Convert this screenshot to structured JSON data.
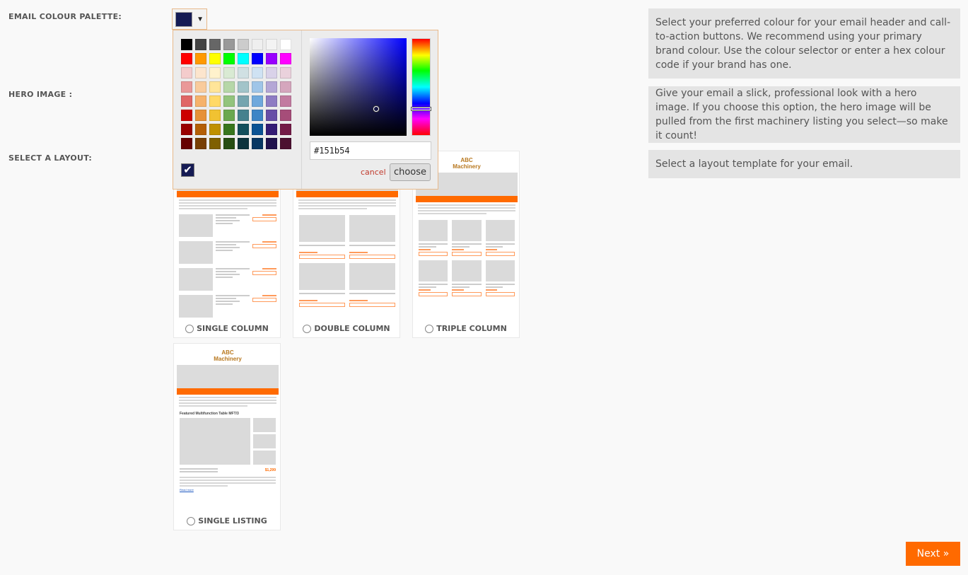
{
  "labels": {
    "email_colour_palette": "EMAIL COLOUR PALETTE:",
    "hero_image": "HERO IMAGE :",
    "select_layout": "SELECT A LAYOUT:"
  },
  "help": {
    "colour": "Select your preferred colour for your email header and call-to-action buttons. We recommend using your primary brand colour. Use the colour selector or enter a hex colour code if your brand has one.",
    "hero": "Give your email a slick, professional look with a hero image. If you choose this option, the hero image will be pulled from the first machinery listing you select—so make it count!",
    "layout": "Select a layout template for your email."
  },
  "colour_picker": {
    "selected_color": "#151b54",
    "hex_value": "#151b54",
    "cancel_label": "cancel",
    "choose_label": "choose",
    "arrow_icon": "caret-down-icon",
    "palette": [
      [
        "#000000",
        "#434343",
        "#666666",
        "#999999",
        "#cccccc",
        "#efefef",
        "#f3f3f3",
        "#ffffff"
      ],
      [
        "#ff0000",
        "#ff9900",
        "#ffff00",
        "#00ff00",
        "#00ffff",
        "#0000ff",
        "#9900ff",
        "#ff00ff"
      ],
      [
        "#f4cccc",
        "#fce5cd",
        "#fff2cc",
        "#d9ead3",
        "#d0e0e3",
        "#cfe2f3",
        "#d9d2e9",
        "#ead1dc"
      ],
      [
        "#ea9999",
        "#f9cb9c",
        "#ffe599",
        "#b6d7a8",
        "#a2c4c9",
        "#9fc5e8",
        "#b4a7d6",
        "#d5a6bd"
      ],
      [
        "#e06666",
        "#f6b26b",
        "#ffd966",
        "#93c47d",
        "#76a5af",
        "#6fa8dc",
        "#8e7cc3",
        "#c27ba0"
      ],
      [
        "#cc0000",
        "#e69138",
        "#f1c232",
        "#6aa84f",
        "#45818e",
        "#3d85c6",
        "#674ea7",
        "#a64d79"
      ],
      [
        "#990000",
        "#b45f06",
        "#bf9000",
        "#38761d",
        "#134f5c",
        "#0b5394",
        "#351c75",
        "#741b47"
      ],
      [
        "#660000",
        "#783f04",
        "#7f6000",
        "#274e13",
        "#0c343d",
        "#073763",
        "#20124d",
        "#4c1130"
      ]
    ]
  },
  "layouts": {
    "single": "SINGLE COLUMN",
    "double": "DOUBLE COLUMN",
    "triple": "TRIPLE COLUMN",
    "listing": "SINGLE LISTING",
    "logo_line1": "ABC",
    "logo_line2": "Machinery",
    "listing_title": "Featured Multifunction Table MFT/3",
    "listing_price": "$1,299",
    "listing_read_more": "Read more"
  },
  "next_label": "Next »"
}
